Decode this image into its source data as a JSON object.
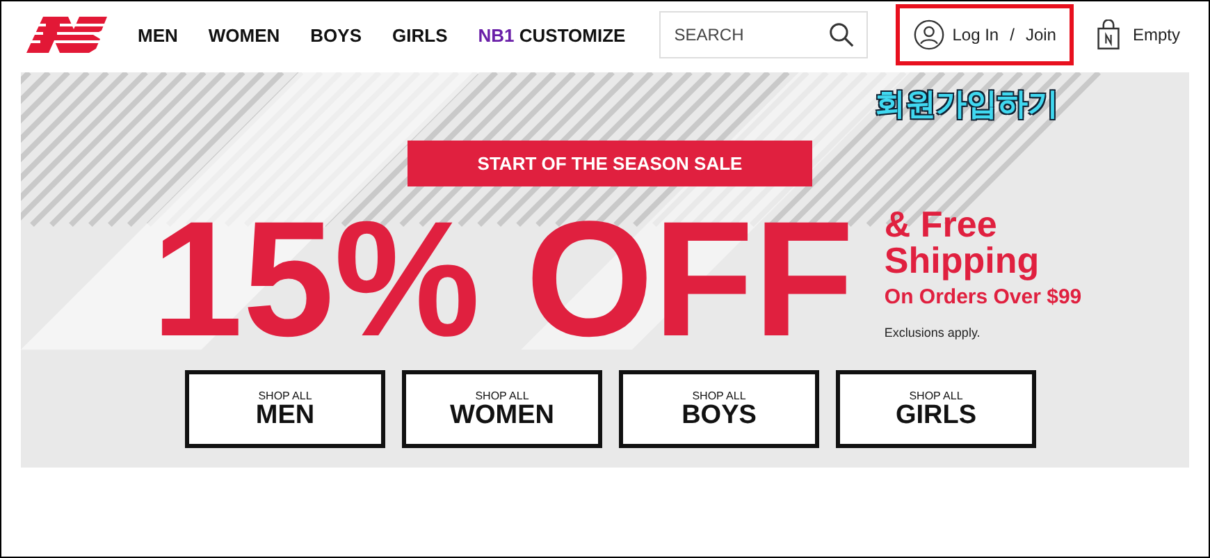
{
  "header": {
    "nav": [
      {
        "label": "MEN"
      },
      {
        "label": "WOMEN"
      },
      {
        "label": "BOYS"
      },
      {
        "label": "GIRLS"
      },
      {
        "prefix": "NB1",
        "label": "CUSTOMIZE"
      }
    ],
    "search": {
      "placeholder": "SEARCH"
    },
    "account": {
      "login": "Log In",
      "separator": "/",
      "join": "Join",
      "highlighted": true
    },
    "cart": {
      "label": "Empty"
    }
  },
  "annotation": {
    "text": "회원가입하기"
  },
  "banner": {
    "tag": "START OF THE SEASON SALE",
    "headline": "15% OFF",
    "offer": "& Free Shipping",
    "condition": "On Orders Over $99",
    "note": "Exclusions apply.",
    "buttons": [
      {
        "small": "SHOP ALL",
        "label": "MEN"
      },
      {
        "small": "SHOP ALL",
        "label": "WOMEN"
      },
      {
        "small": "SHOP ALL",
        "label": "BOYS"
      },
      {
        "small": "SHOP ALL",
        "label": "GIRLS"
      }
    ]
  }
}
